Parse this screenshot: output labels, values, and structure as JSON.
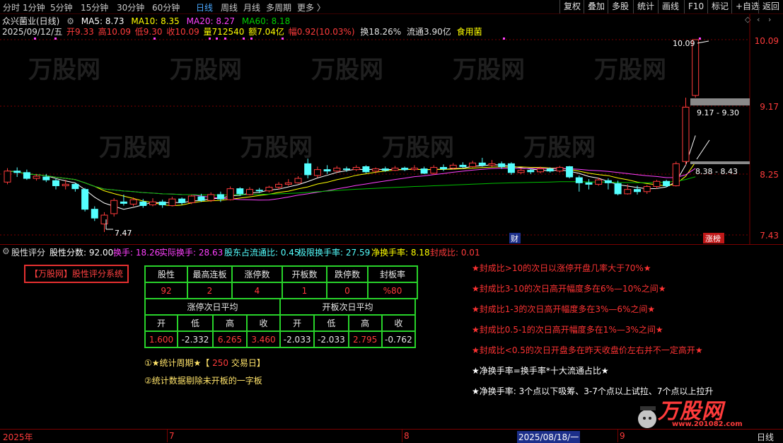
{
  "toolbar": {
    "periods": [
      "分时",
      "1分钟",
      "5分钟",
      "15分钟",
      "30分钟",
      "60分钟",
      "日线",
      "周线",
      "月线",
      "多周期",
      "更多 〉"
    ],
    "right": [
      "复权",
      "叠加",
      "多股",
      "统计",
      "画线",
      "F10",
      "标记",
      "+自选",
      "返回"
    ]
  },
  "header": {
    "stock": "众兴菌业(日线)",
    "ma5": "MA5: 8.73",
    "ma10": "MA10: 8.35",
    "ma20": "MA20: 8.27",
    "ma60": "MA60: 8.18",
    "date": "2025/09/12/五",
    "open": "开9.33",
    "high": "高10.09",
    "low": "低9.30",
    "close": "收10.09",
    "vol": "量712540",
    "amount": "额7.04亿",
    "change": "幅0.92(10.03%)",
    "turnover": "换18.26%",
    "float": "流通3.90亿",
    "sector": "食用菌"
  },
  "price_axis": [
    "10.09",
    "9.17",
    "8.25",
    "7.43"
  ],
  "annotations": {
    "high_label": "10.09",
    "range1": "9.17 - 9.30",
    "range2": "8.38 - 8.43",
    "low_label": "7.47",
    "cai": "财",
    "zhangbang": "涨榜"
  },
  "colors": {
    "up": "#ff3b3b",
    "down": "#54ffff",
    "ma5": "#ffffff",
    "ma10": "#ffff00",
    "ma20": "#ff40ff",
    "ma60": "#00c000"
  },
  "candles": [
    {
      "o": 8.15,
      "c": 8.3,
      "h": 8.34,
      "l": 8.12
    },
    {
      "o": 8.3,
      "c": 8.28,
      "h": 8.35,
      "l": 8.22
    },
    {
      "o": 8.28,
      "c": 8.2,
      "h": 8.32,
      "l": 8.18
    },
    {
      "o": 8.2,
      "c": 8.23,
      "h": 8.26,
      "l": 8.17
    },
    {
      "o": 8.22,
      "c": 8.18,
      "h": 8.26,
      "l": 8.15
    },
    {
      "o": 8.17,
      "c": 8.1,
      "h": 8.2,
      "l": 8.05
    },
    {
      "o": 8.1,
      "c": 8.12,
      "h": 8.18,
      "l": 8.05
    },
    {
      "o": 8.12,
      "c": 8.06,
      "h": 8.14,
      "l": 8.02
    },
    {
      "o": 8.05,
      "c": 7.78,
      "h": 8.07,
      "l": 7.75
    },
    {
      "o": 7.78,
      "c": 7.66,
      "h": 7.82,
      "l": 7.62
    },
    {
      "o": 7.58,
      "c": 7.7,
      "h": 7.74,
      "l": 7.47
    },
    {
      "o": 7.72,
      "c": 7.9,
      "h": 7.93,
      "l": 7.68
    },
    {
      "o": 7.88,
      "c": 7.86,
      "h": 7.98,
      "l": 7.83
    },
    {
      "o": 7.85,
      "c": 7.91,
      "h": 7.94,
      "l": 7.82
    },
    {
      "o": 7.88,
      "c": 7.83,
      "h": 7.92,
      "l": 7.8
    },
    {
      "o": 7.84,
      "c": 7.88,
      "h": 7.93,
      "l": 7.82
    },
    {
      "o": 7.88,
      "c": 7.84,
      "h": 7.91,
      "l": 7.8
    },
    {
      "o": 7.83,
      "c": 7.92,
      "h": 7.95,
      "l": 7.82
    },
    {
      "o": 7.92,
      "c": 7.87,
      "h": 7.94,
      "l": 7.84
    },
    {
      "o": 7.87,
      "c": 7.96,
      "h": 7.98,
      "l": 7.85
    },
    {
      "o": 7.95,
      "c": 7.9,
      "h": 7.99,
      "l": 7.88
    },
    {
      "o": 7.9,
      "c": 7.98,
      "h": 8.01,
      "l": 7.88
    },
    {
      "o": 7.98,
      "c": 7.92,
      "h": 8.02,
      "l": 7.88
    },
    {
      "o": 7.91,
      "c": 8.06,
      "h": 8.09,
      "l": 7.9
    },
    {
      "o": 8.06,
      "c": 7.99,
      "h": 8.08,
      "l": 7.96
    },
    {
      "o": 7.98,
      "c": 8.05,
      "h": 8.08,
      "l": 7.97
    },
    {
      "o": 8.04,
      "c": 8.03,
      "h": 8.07,
      "l": 8.0
    },
    {
      "o": 8.03,
      "c": 8.08,
      "h": 8.1,
      "l": 8.01
    },
    {
      "o": 8.08,
      "c": 8.12,
      "h": 8.15,
      "l": 8.05
    },
    {
      "o": 8.12,
      "c": 8.14,
      "h": 8.19,
      "l": 8.1
    },
    {
      "o": 8.14,
      "c": 8.2,
      "h": 8.23,
      "l": 8.13
    },
    {
      "o": 8.4,
      "c": 8.25,
      "h": 8.47,
      "l": 8.2
    },
    {
      "o": 8.24,
      "c": 8.32,
      "h": 8.36,
      "l": 8.21
    },
    {
      "o": 8.32,
      "c": 8.3,
      "h": 8.38,
      "l": 8.26
    },
    {
      "o": 8.3,
      "c": 8.34,
      "h": 8.37,
      "l": 8.28
    },
    {
      "o": 8.33,
      "c": 8.32,
      "h": 8.36,
      "l": 8.29
    },
    {
      "o": 8.32,
      "c": 8.35,
      "h": 8.38,
      "l": 8.3
    },
    {
      "o": 8.36,
      "c": 8.29,
      "h": 8.38,
      "l": 8.27
    },
    {
      "o": 8.3,
      "c": 8.33,
      "h": 8.35,
      "l": 8.27
    },
    {
      "o": 8.33,
      "c": 8.31,
      "h": 8.36,
      "l": 8.29
    },
    {
      "o": 8.31,
      "c": 8.34,
      "h": 8.37,
      "l": 8.3
    },
    {
      "o": 8.34,
      "c": 8.32,
      "h": 8.36,
      "l": 8.3
    },
    {
      "o": 8.32,
      "c": 8.34,
      "h": 8.38,
      "l": 8.3
    },
    {
      "o": 8.33,
      "c": 8.27,
      "h": 8.36,
      "l": 8.26
    },
    {
      "o": 8.27,
      "c": 8.35,
      "h": 8.38,
      "l": 8.25
    },
    {
      "o": 8.35,
      "c": 8.33,
      "h": 8.39,
      "l": 8.3
    },
    {
      "o": 8.34,
      "c": 8.38,
      "h": 8.41,
      "l": 8.32
    },
    {
      "o": 8.38,
      "c": 8.36,
      "h": 8.42,
      "l": 8.34
    },
    {
      "o": 8.36,
      "c": 8.41,
      "h": 8.44,
      "l": 8.35
    },
    {
      "o": 8.41,
      "c": 8.38,
      "h": 8.48,
      "l": 8.36
    },
    {
      "o": 8.38,
      "c": 8.4,
      "h": 8.45,
      "l": 8.36
    },
    {
      "o": 8.4,
      "c": 8.36,
      "h": 8.43,
      "l": 8.33
    },
    {
      "o": 8.4,
      "c": 8.28,
      "h": 8.42,
      "l": 8.25
    },
    {
      "o": 8.28,
      "c": 8.31,
      "h": 8.34,
      "l": 8.26
    },
    {
      "o": 8.31,
      "c": 8.29,
      "h": 8.33,
      "l": 8.26
    },
    {
      "o": 8.29,
      "c": 8.33,
      "h": 8.36,
      "l": 8.27
    },
    {
      "o": 8.33,
      "c": 8.3,
      "h": 8.35,
      "l": 8.28
    },
    {
      "o": 8.3,
      "c": 8.35,
      "h": 8.37,
      "l": 8.28
    },
    {
      "o": 8.36,
      "c": 8.22,
      "h": 8.37,
      "l": 8.2
    },
    {
      "o": 8.21,
      "c": 8.14,
      "h": 8.24,
      "l": 8.02
    },
    {
      "o": 8.14,
      "c": 8.12,
      "h": 8.19,
      "l": 8.05
    },
    {
      "o": 8.12,
      "c": 8.18,
      "h": 8.21,
      "l": 8.1
    },
    {
      "o": 8.17,
      "c": 8.14,
      "h": 8.2,
      "l": 8.05
    },
    {
      "o": 8.13,
      "c": 7.99,
      "h": 8.17,
      "l": 7.97
    },
    {
      "o": 7.99,
      "c": 8.05,
      "h": 8.12,
      "l": 7.98
    },
    {
      "o": 8.05,
      "c": 8.02,
      "h": 8.1,
      "l": 7.98
    },
    {
      "o": 8.02,
      "c": 8.09,
      "h": 8.11,
      "l": 7.99
    },
    {
      "o": 8.09,
      "c": 8.16,
      "h": 8.18,
      "l": 8.06
    },
    {
      "o": 8.16,
      "c": 8.1,
      "h": 8.18,
      "l": 8.08
    },
    {
      "o": 8.1,
      "c": 8.4,
      "h": 8.43,
      "l": 8.09
    },
    {
      "o": 8.43,
      "c": 9.17,
      "h": 9.3,
      "l": 8.38
    },
    {
      "o": 9.33,
      "c": 10.09,
      "h": 10.09,
      "l": 9.3
    }
  ],
  "panel": {
    "name": "股性评分",
    "score": "股性分数: 92.00",
    "huanshou": "换手: 18.26",
    "shiji": "实际换手: 28.63",
    "gudong": "股东占流通比: 0.45",
    "jixian": "极限换手率: 27.59",
    "jing": "净换手率: 8.18",
    "fengcheng": "封成比: 0.01",
    "system_title": "【万股网】股性评分系统",
    "table_head": [
      "股性",
      "最高连板",
      "涨停数",
      "开板数",
      "跌停数",
      "封板率"
    ],
    "table_vals": [
      "92",
      "2",
      "4",
      "1",
      "0",
      "%80"
    ],
    "group1": "涨停次日平均",
    "group2": "开板次日平均",
    "sub_head": [
      "开",
      "低",
      "高",
      "收",
      "开",
      "低",
      "高",
      "收"
    ],
    "sub_vals": [
      "1.600",
      "-2.332",
      "6.265",
      "3.460",
      "-2.033",
      "-2.033",
      "2.795",
      "-0.762"
    ],
    "note1a": "①★统计周期★【",
    "note1b": "250",
    "note1c": "交易日】",
    "note2": "②统计数据剔除未开板的一字板",
    "rules": [
      "★封成比>10的次日以涨停开盘几率大于70%★",
      "★封成比3-10的次日高开幅度多在6%—10%之间★",
      "★封成比1-3的次日高开幅度多在3%—6%之间★",
      "★封成比0.5-1的次日高开幅度多在1%—3%之间★",
      "★封成比<0.5的次日开盘多在昨天收盘价左右并不一定高开★"
    ],
    "formula": "★净换手率=换手率*十大流通占比★",
    "tip": "★净换手率:  3个点以下吸筹、3-7个点以上试拉、7个点以上拉升"
  },
  "bottom": {
    "year": "2025年",
    "m7": "7",
    "m8": "8",
    "date": "2025/08/18/一",
    "m9": "9",
    "period": "日线"
  },
  "watermark": {
    "brand": "万股网",
    "url": "www.201082.com"
  }
}
